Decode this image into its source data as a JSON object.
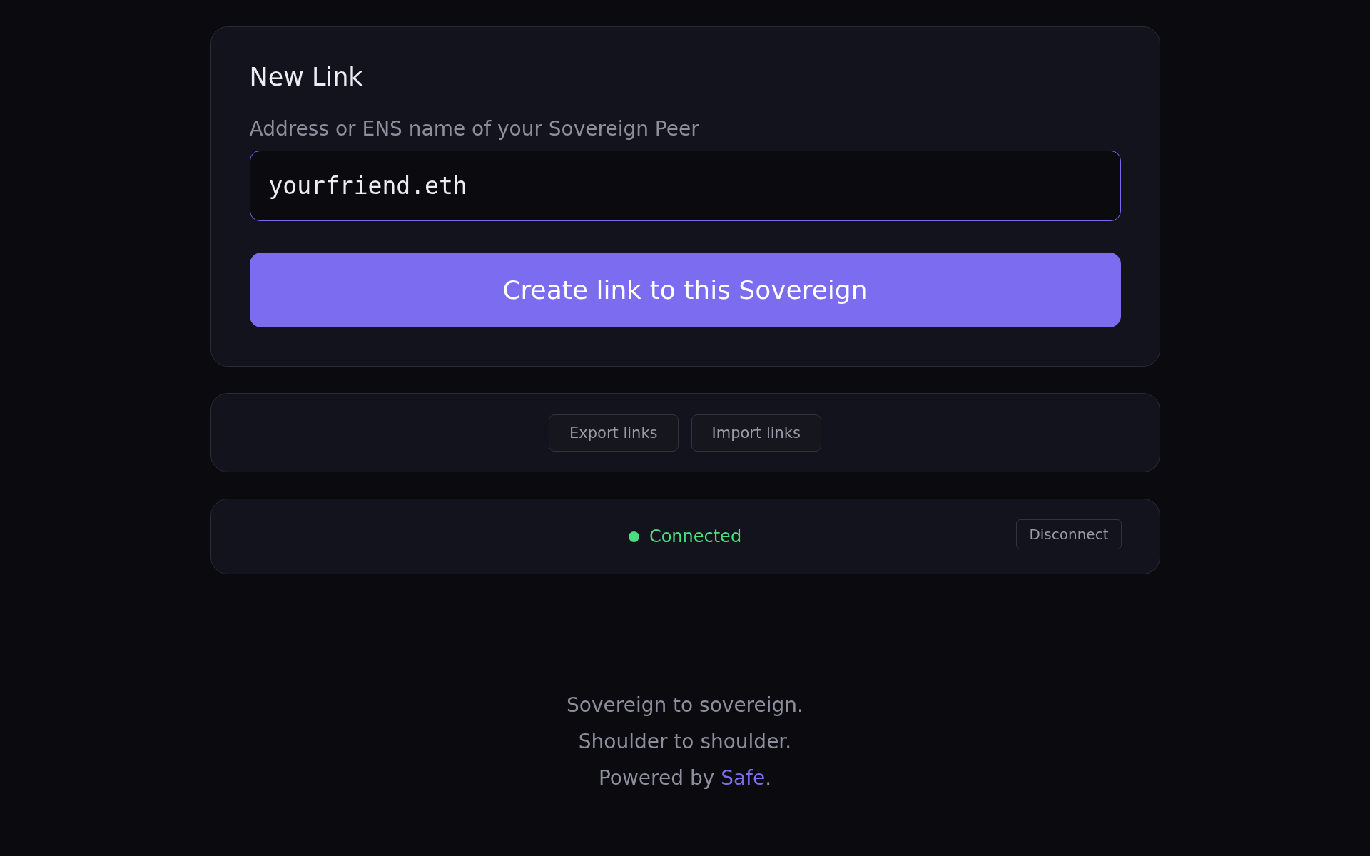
{
  "new_link": {
    "title": "New Link",
    "field_label": "Address or ENS name of your Sovereign Peer",
    "input": {
      "value": "yourfriend.eth",
      "focused": true
    },
    "submit": "Create link to this Sovereign"
  },
  "link_actions": [
    "Export links",
    "Import links"
  ],
  "connection": {
    "status": "Connected",
    "connected": true,
    "button": "Disconnect"
  },
  "footer": {
    "lines": [
      "Sovereign to sovereign.",
      "Shoulder to shoulder."
    ],
    "powered": {
      "prefix": "Powered by ",
      "link": "Safe",
      "suffix": "."
    }
  }
}
